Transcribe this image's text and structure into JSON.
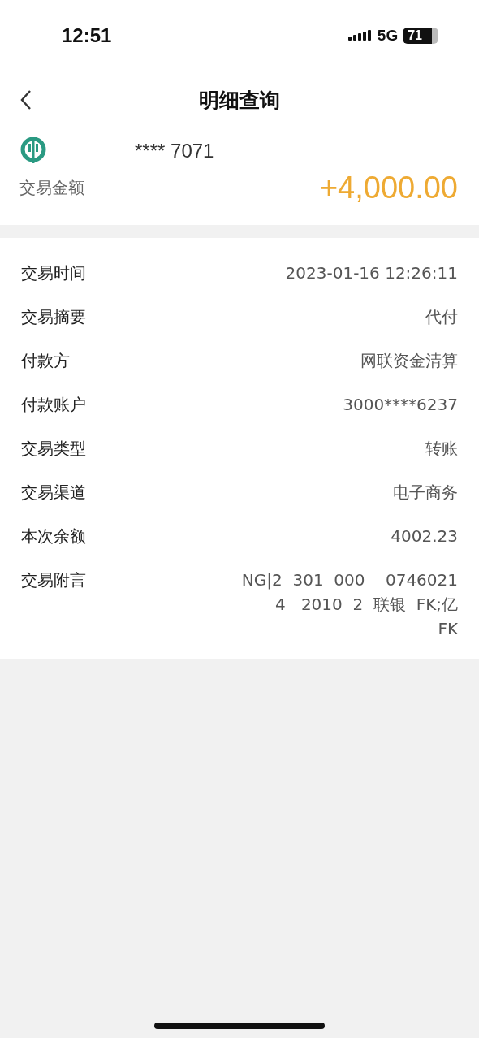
{
  "status_bar": {
    "time": "12:51",
    "network": "5G",
    "battery": "71"
  },
  "header": {
    "title": "明细查询"
  },
  "account": {
    "number": "**** 7071",
    "amount_label": "交易金额",
    "amount": "+4,000.00"
  },
  "details": [
    {
      "label": "交易时间",
      "value": [
        "2023-01-16 12:26:11"
      ]
    },
    {
      "label": "交易摘要",
      "value": [
        "代付"
      ]
    },
    {
      "label": "付款方",
      "value": [
        "网联资金清算"
      ]
    },
    {
      "label": "付款账户",
      "value": [
        "3000****6237"
      ]
    },
    {
      "label": "交易类型",
      "value": [
        "转账"
      ]
    },
    {
      "label": "交易渠道",
      "value": [
        "电子商务"
      ]
    },
    {
      "label": "本次余额",
      "value": [
        "4002.23"
      ]
    },
    {
      "label": "交易附言",
      "value": [
        "NG|2  301  000    0746021",
        "4   2010  2  联银  FK;亿",
        "FK"
      ]
    }
  ]
}
